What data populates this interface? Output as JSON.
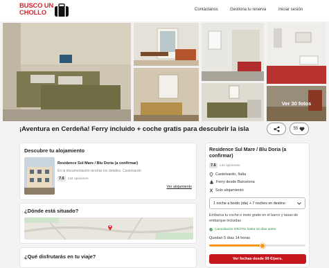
{
  "header": {
    "logo_line1": "BUSCO UN",
    "logo_line2": "CHOLLO",
    "nav": [
      "Contáctanos",
      "Gestiona tu reserva",
      "Iniciar sesión"
    ]
  },
  "gallery": {
    "more_label": "Ver 30 fotos"
  },
  "title": "¡Aventura en Cerdeña! Ferry incluido + coche gratis para descubrir la isla",
  "actions": {
    "likes": "55"
  },
  "accommodation": {
    "section_title": "Descubre tu alojamiento",
    "hotel_name": "Residence Sul Mare / Blu Doria (a confirmar)",
    "hotel_note": "En la documentación tendrás los detalles, Castelsardo",
    "rating": "7.6",
    "reviews": "134 opiniones",
    "link": "Ver alojamiento"
  },
  "location": {
    "section_title": "¿Dónde está situado?"
  },
  "enjoy": {
    "section_title": "¿Qué disfrutarás en tu viaje?"
  },
  "sidebar": {
    "hotel_name": "Residence Sul Mare / Blu Doria (a confirmar)",
    "rating": "7.6",
    "reviews": "134 opiniones",
    "location": "Castelsardo, Italia",
    "ferry": "Ferry desde Barcelona",
    "board": "Solo alojamiento",
    "select_value": "1 noche a bordo (ida) + 7 noches en destino",
    "promo": "Embarca tu coche o moto gratis en el barco y tasas de embarque incluidas",
    "cancel": "Cancelación GRATIS hasta 15 días antes",
    "countdown": "Quedan 5 días 14 horas",
    "cta": "Ver fechas desde 99 €/pers."
  },
  "colors": {
    "brand": "#c4161c",
    "green": "#2e8b3d",
    "progress": "#f7941d"
  }
}
